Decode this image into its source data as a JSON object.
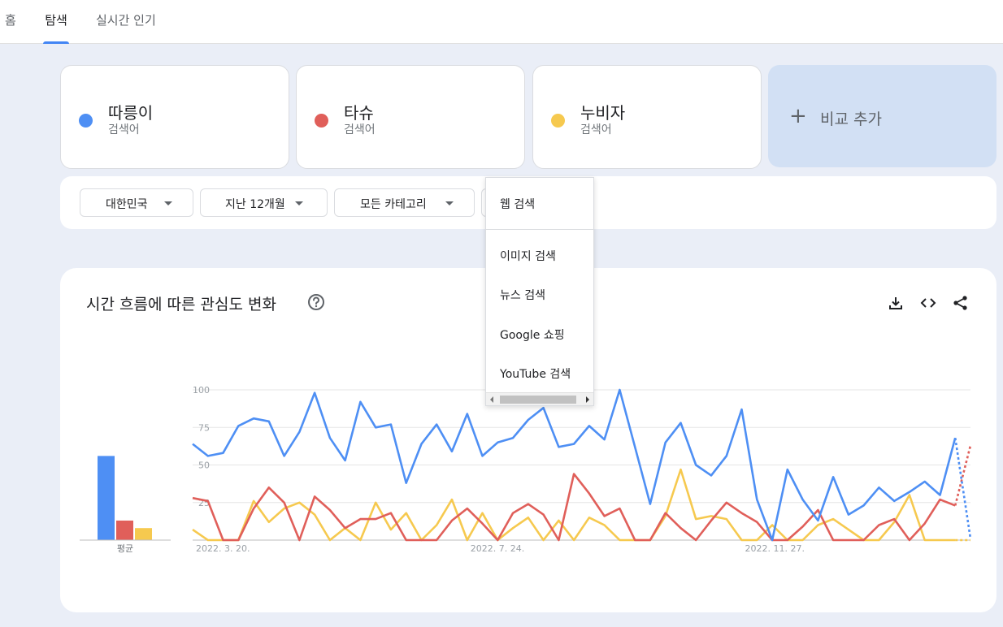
{
  "nav": {
    "tabs": [
      {
        "label": "홈"
      },
      {
        "label": "탐색"
      },
      {
        "label": "실시간 인기"
      }
    ],
    "active": "탐색",
    "accent": "#4285f4"
  },
  "terms": [
    {
      "name": "따릉이",
      "type": "검색어",
      "color": "#4e8ff4"
    },
    {
      "name": "타슈",
      "type": "검색어",
      "color": "#e05f5a"
    },
    {
      "name": "누비자",
      "type": "검색어",
      "color": "#f6c94f"
    }
  ],
  "add_compare": {
    "label": "비교 추가",
    "icon": "plus-icon"
  },
  "filters": {
    "region": "대한민국",
    "period": "지난 12개월",
    "category": "모든 카테고리"
  },
  "search_type_menu": {
    "items": [
      "웹 검색",
      "이미지 검색",
      "뉴스 검색",
      "Google 쇼핑",
      "YouTube 검색"
    ]
  },
  "chart_card": {
    "title": "시간 흐름에 따른 관심도 변화",
    "icons": [
      "help-icon",
      "download-icon",
      "embed-code-icon",
      "share-icon"
    ]
  },
  "chart_data": {
    "type": "line",
    "ylim": [
      0,
      100
    ],
    "yticks": [
      25,
      50,
      75,
      100
    ],
    "x_tick_labels": [
      {
        "label": "2022. 3. 20.",
        "index": 0
      },
      {
        "label": "2022. 7. 24.",
        "index": 18
      },
      {
        "label": "2022. 11. 27.",
        "index": 36
      }
    ],
    "grid": true,
    "partial_last_point": true,
    "series": [
      {
        "name": "따릉이",
        "color": "#4e8ff4",
        "values": [
          64,
          56,
          58,
          76,
          81,
          79,
          56,
          72,
          98,
          68,
          53,
          92,
          75,
          77,
          38,
          64,
          77,
          59,
          84,
          56,
          65,
          68,
          80,
          88,
          62,
          64,
          76,
          67,
          100,
          62,
          24,
          65,
          78,
          50,
          43,
          56,
          87,
          27,
          0,
          47,
          27,
          13,
          42,
          17,
          23,
          35,
          26,
          32,
          39,
          30,
          68,
          1
        ]
      },
      {
        "name": "타슈",
        "color": "#e05f5a",
        "values": [
          28,
          26,
          0,
          0,
          21,
          35,
          25,
          0,
          29,
          20,
          8,
          14,
          14,
          18,
          0,
          0,
          0,
          13,
          21,
          11,
          0,
          18,
          24,
          17,
          0,
          44,
          31,
          16,
          21,
          0,
          0,
          18,
          8,
          0,
          13,
          25,
          18,
          12,
          0,
          0,
          9,
          20,
          0,
          0,
          0,
          10,
          14,
          0,
          11,
          27,
          23,
          63
        ]
      },
      {
        "name": "누비자",
        "color": "#f6c94f",
        "values": [
          7,
          0,
          0,
          0,
          26,
          12,
          21,
          25,
          17,
          0,
          8,
          0,
          25,
          7,
          18,
          0,
          10,
          27,
          0,
          18,
          0,
          8,
          15,
          0,
          13,
          0,
          15,
          10,
          0,
          0,
          0,
          16,
          47,
          14,
          16,
          14,
          0,
          0,
          10,
          0,
          0,
          10,
          14,
          7,
          0,
          0,
          12,
          30,
          0,
          0,
          0,
          0
        ]
      }
    ],
    "average": {
      "label": "평균",
      "bars": [
        {
          "name": "따릉이",
          "value": 56,
          "color": "#4e8ff4"
        },
        {
          "name": "타슈",
          "value": 13,
          "color": "#e05f5a"
        },
        {
          "name": "누비자",
          "value": 8,
          "color": "#f6c94f"
        }
      ]
    }
  }
}
